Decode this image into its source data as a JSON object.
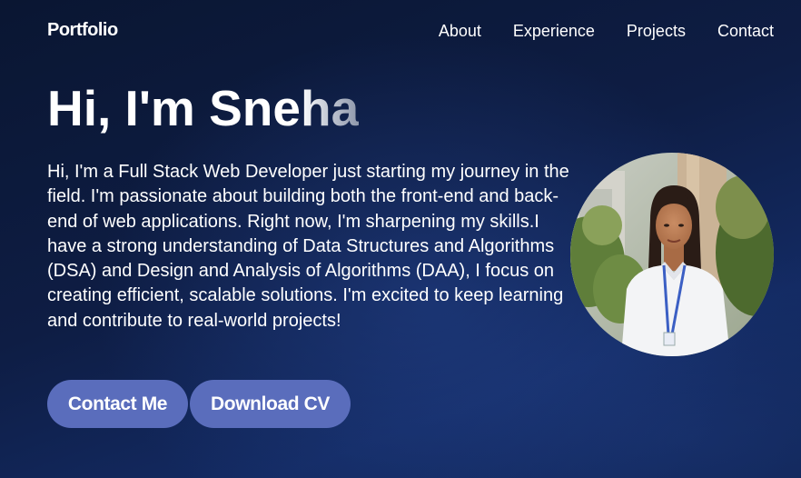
{
  "brand": "Portfolio",
  "nav": {
    "items": [
      "About",
      "Experience",
      "Projects",
      "Contact"
    ]
  },
  "hero": {
    "title_main": "Hi, I'm Sne",
    "title_fade": "ha",
    "intro": "Hi, I'm a Full Stack Web Developer just starting my journey in the field. I'm passionate about building both the front-end and back-end of web applications. Right now, I'm sharpening my skills.I have a strong understanding of Data Structures and Algorithms (DSA) and Design and Analysis of Algorithms (DAA), I focus on creating efficient, scalable solutions. I'm excited to keep learning and contribute to real-world projects!"
  },
  "buttons": {
    "contact": "Contact Me",
    "download": "Download CV"
  },
  "colors": {
    "background": "#0e1d44",
    "button": "#5a6dbc",
    "text": "#ffffff"
  }
}
